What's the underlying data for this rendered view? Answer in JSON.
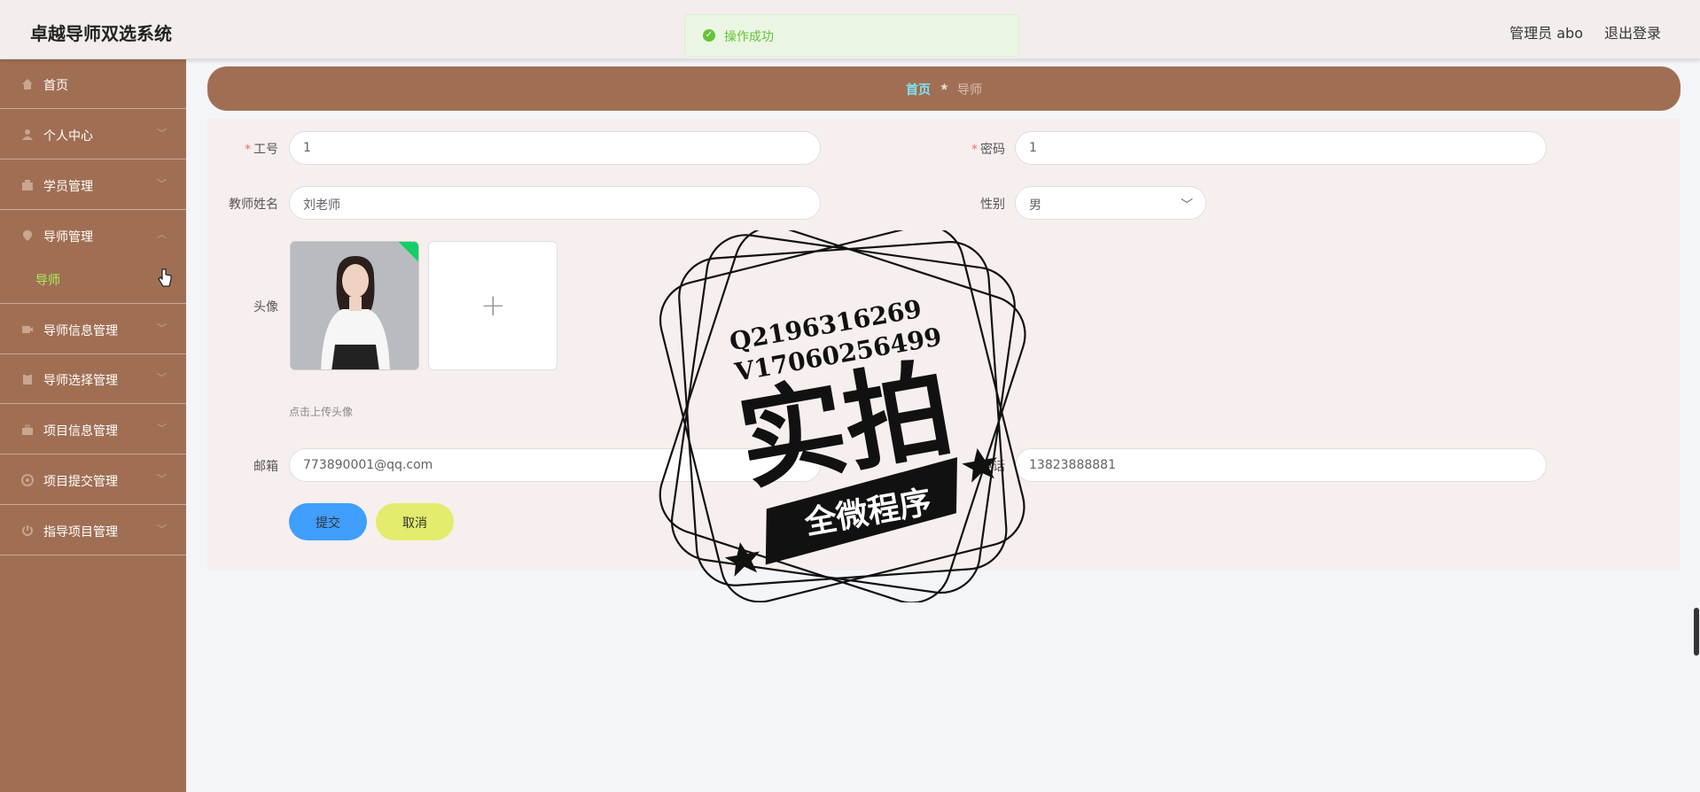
{
  "header": {
    "app_title": "卓越导师双选系统",
    "user": "管理员 abo",
    "logout": "退出登录"
  },
  "toast": {
    "message": "操作成功"
  },
  "sidebar": {
    "items": [
      {
        "label": "首页",
        "icon": "home-icon"
      },
      {
        "label": "个人中心",
        "icon": "user-icon"
      },
      {
        "label": "学员管理",
        "icon": "students-icon"
      },
      {
        "label": "导师管理",
        "icon": "location-icon",
        "expanded": true
      },
      {
        "label": "导师信息管理",
        "icon": "video-icon"
      },
      {
        "label": "导师选择管理",
        "icon": "clipboard-icon"
      },
      {
        "label": "项目信息管理",
        "icon": "briefcase-icon"
      },
      {
        "label": "项目提交管理",
        "icon": "aperture-icon"
      },
      {
        "label": "指导项目管理",
        "icon": "power-icon"
      }
    ],
    "sub_item": "导师"
  },
  "breadcrumb": {
    "home": "首页",
    "current": "导师"
  },
  "form": {
    "work_id_label": "工号",
    "work_id_value": "1",
    "password_label": "密码",
    "password_value": "1",
    "name_label": "教师姓名",
    "name_value": "刘老师",
    "gender_label": "性别",
    "gender_value": "男",
    "avatar_label": "头像",
    "avatar_hint": "点击上传头像",
    "email_label": "邮箱",
    "email_value": "773890001@qq.com",
    "phone_label": "电话",
    "phone_value": "13823888881",
    "submit": "提交",
    "cancel": "取消"
  },
  "watermark": {
    "line1": "Q2196316269",
    "line2": "V17060256499",
    "main": "实拍",
    "ribbon": "全微程序"
  },
  "colors": {
    "sidebar_bg": "#a06f53",
    "accent_active": "#a6f05a",
    "primary": "#409eff",
    "cancel": "#e3ec6c",
    "success": "#67c23a"
  }
}
